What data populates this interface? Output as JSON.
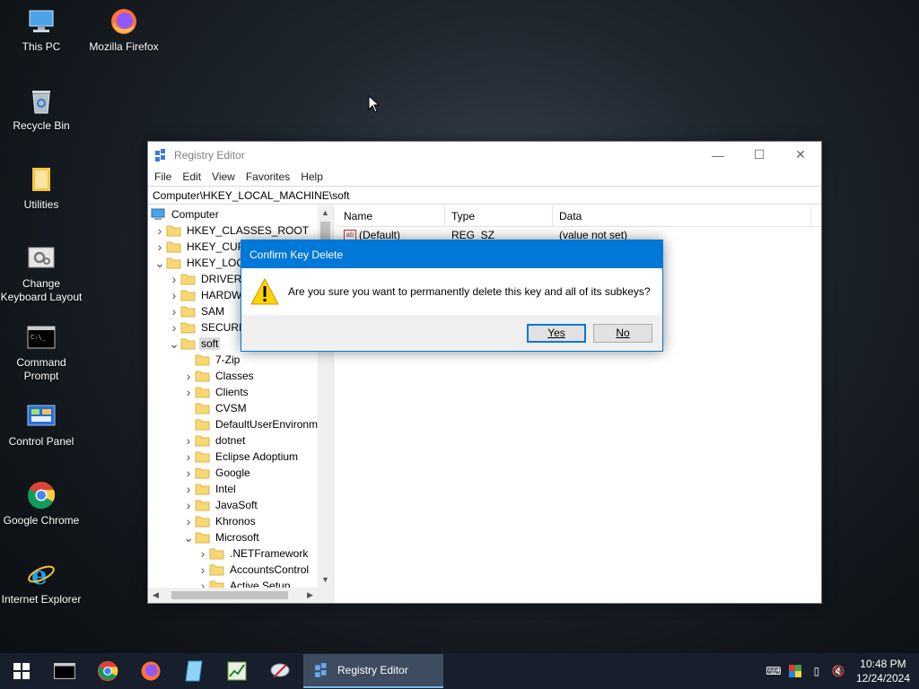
{
  "desktop": {
    "icons": [
      {
        "label": "This PC"
      },
      {
        "label": "Mozilla Firefox"
      },
      {
        "label": "Recycle Bin"
      },
      {
        "label": "Utilities"
      },
      {
        "label": "Change Keyboard Layout"
      },
      {
        "label": "Command Prompt"
      },
      {
        "label": "Control Panel"
      },
      {
        "label": "Google Chrome"
      },
      {
        "label": "Internet Explorer"
      }
    ]
  },
  "window": {
    "title": "Registry Editor",
    "menu": [
      "File",
      "Edit",
      "View",
      "Favorites",
      "Help"
    ],
    "address": "Computer\\HKEY_LOCAL_MACHINE\\soft",
    "tree": [
      {
        "label": "Computer"
      },
      {
        "label": "HKEY_CLASSES_ROOT"
      },
      {
        "label": "HKEY_CURRENT_USER"
      },
      {
        "label": "HKEY_LOCAL_MACHINE"
      },
      {
        "label": "DRIVERS"
      },
      {
        "label": "HARDWARE"
      },
      {
        "label": "SAM"
      },
      {
        "label": "SECURITY"
      },
      {
        "label": "soft"
      },
      {
        "label": "7-Zip"
      },
      {
        "label": "Classes"
      },
      {
        "label": "Clients"
      },
      {
        "label": "CVSM"
      },
      {
        "label": "DefaultUserEnvironment"
      },
      {
        "label": "dotnet"
      },
      {
        "label": "Eclipse Adoptium"
      },
      {
        "label": "Google"
      },
      {
        "label": "Intel"
      },
      {
        "label": "JavaSoft"
      },
      {
        "label": "Khronos"
      },
      {
        "label": "Microsoft"
      },
      {
        "label": ".NETFramework"
      },
      {
        "label": "AccountsControl"
      },
      {
        "label": "Active Setup"
      }
    ],
    "columns": {
      "name": "Name",
      "type": "Type",
      "data": "Data"
    },
    "values": [
      {
        "name": "(Default)",
        "type": "REG_SZ",
        "data": "(value not set)"
      }
    ]
  },
  "dialog": {
    "title": "Confirm Key Delete",
    "message": "Are you sure you want to permanently delete this key and all of its subkeys?",
    "yes": "Yes",
    "no": "No"
  },
  "taskbar": {
    "active_app": "Registry Editor",
    "time": "10:48 PM",
    "date": "12/24/2024"
  },
  "colors": {
    "accent": "#0078d7",
    "folder": "#f8d775",
    "taskbar": "#161f2b"
  }
}
